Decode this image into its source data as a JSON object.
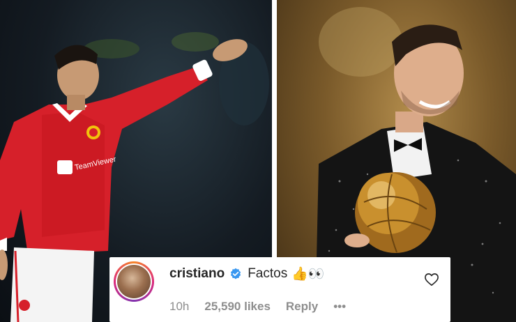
{
  "comment": {
    "username": "cristiano",
    "text": "Factos",
    "emoji": "👍👀",
    "time": "10h",
    "likes": "25,590 likes",
    "reply": "Reply",
    "more": "•••"
  }
}
